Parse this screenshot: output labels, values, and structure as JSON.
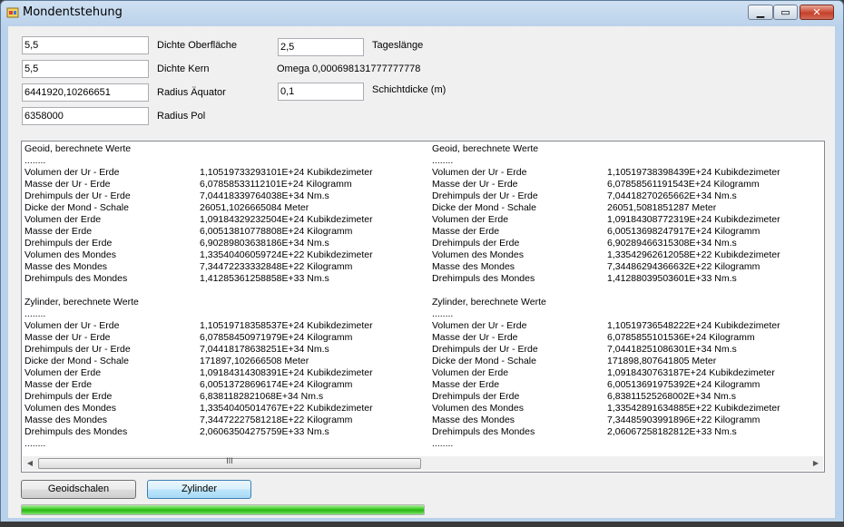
{
  "window": {
    "title": "Mondentstehung"
  },
  "inputs": {
    "dichte_oberflaeche": {
      "value": "5,5",
      "label": "Dichte Oberfläche"
    },
    "dichte_kern": {
      "value": "5,5",
      "label": "Dichte Kern"
    },
    "radius_aequator": {
      "value": "6441920,10266651",
      "label": "Radius Äquator"
    },
    "radius_pol": {
      "value": "6358000",
      "label": "Radius Pol"
    },
    "tageslaenge": {
      "value": "2,5",
      "label": "Tageslänge"
    },
    "omega": {
      "text": "Omega 0,000698131777777778"
    },
    "schichtdicke": {
      "value": "0,1",
      "label": "Schichtdicke (m)"
    }
  },
  "output": {
    "left": [
      [
        "Geoid, berechnete Werte",
        ""
      ],
      [
        "........",
        ""
      ],
      [
        "Volumen der Ur - Erde",
        "1,10519733293101E+24 Kubikdezimeter"
      ],
      [
        "Masse der Ur - Erde",
        "6,07858533112101E+24 Kilogramm"
      ],
      [
        "Drehimpuls der Ur - Erde",
        "7,04418339764038E+34 Nm.s"
      ],
      [
        "Dicke der Mond - Schale",
        "26051,1026665084 Meter"
      ],
      [
        "Volumen der Erde",
        "1,09184329232504E+24 Kubikdezimeter"
      ],
      [
        "Masse der Erde",
        "6,00513810778808E+24 Kilogramm"
      ],
      [
        "Drehimpuls der Erde",
        "6,90289803638186E+34 Nm.s"
      ],
      [
        "Volumen des Mondes",
        "1,33540406059724E+22 Kubikdezimeter"
      ],
      [
        "Masse des Mondes",
        "7,34472233332848E+22 Kilogramm"
      ],
      [
        "Drehimpuls des Mondes",
        "1,41285361258858E+33 Nm.s"
      ],
      [
        "",
        ""
      ],
      [
        "Zylinder, berechnete Werte",
        ""
      ],
      [
        "........",
        ""
      ],
      [
        "Volumen der Ur - Erde",
        "1,10519718358537E+24 Kubikdezimeter"
      ],
      [
        "Masse der Ur - Erde",
        "6,07858450971979E+24 Kilogramm"
      ],
      [
        "Drehimpuls der Ur - Erde",
        "7,04418178638251E+34 Nm.s"
      ],
      [
        "Dicke der Mond - Schale",
        "171897,102666508 Meter"
      ],
      [
        "Volumen der Erde",
        "1,09184314308391E+24 Kubikdezimeter"
      ],
      [
        "Masse der Erde",
        "6,00513728696174E+24 Kilogramm"
      ],
      [
        "Drehimpuls der Erde",
        "6,8381182821068E+34 Nm.s"
      ],
      [
        "Volumen des Mondes",
        "1,33540405014767E+22 Kubikdezimeter"
      ],
      [
        "Masse des Mondes",
        "7,34472227581218E+22 Kilogramm"
      ],
      [
        "Drehimpuls des Mondes",
        "2,06063504275759E+33 Nm.s"
      ],
      [
        "........",
        ""
      ]
    ],
    "right": [
      [
        "Geoid, berechnete Werte",
        ""
      ],
      [
        "........",
        ""
      ],
      [
        "Volumen der Ur - Erde",
        "1,10519738398439E+24 Kubikdezimeter"
      ],
      [
        "Masse der Ur - Erde",
        "6,07858561191543E+24 Kilogramm"
      ],
      [
        "Drehimpuls der Ur - Erde",
        "7,04418270265662E+34 Nm.s"
      ],
      [
        "Dicke der Mond - Schale",
        "26051,5081851287 Meter"
      ],
      [
        "Volumen der Erde",
        "1,09184308772319E+24 Kubikdezimeter"
      ],
      [
        "Masse der Erde",
        "6,00513698247917E+24 Kilogramm"
      ],
      [
        "Drehimpuls der Erde",
        "6,90289466315308E+34 Nm.s"
      ],
      [
        "Volumen des Mondes",
        "1,33542962612058E+22 Kubikdezimeter"
      ],
      [
        "Masse des Mondes",
        "7,34486294366632E+22 Kilogramm"
      ],
      [
        "Drehimpuls des Mondes",
        "1,41288039503601E+33 Nm.s"
      ],
      [
        "",
        ""
      ],
      [
        "Zylinder, berechnete Werte",
        ""
      ],
      [
        "........",
        ""
      ],
      [
        "Volumen der Ur - Erde",
        "1,10519736548222E+24 Kubikdezimeter"
      ],
      [
        "Masse der Ur - Erde",
        "6,0785855101536E+24 Kilogramm"
      ],
      [
        "Drehimpuls der Ur - Erde",
        "7,04418251086301E+34 Nm.s"
      ],
      [
        "Dicke der Mond - Schale",
        "171898,807641805 Meter"
      ],
      [
        "Volumen der Erde",
        "1,0918430763187E+24 Kubikdezimeter"
      ],
      [
        "Masse der Erde",
        "6,00513691975392E+24 Kilogramm"
      ],
      [
        "Drehimpuls der Erde",
        "6,83811525268002E+34 Nm.s"
      ],
      [
        "Volumen des Mondes",
        "1,33542891634885E+22 Kubikdezimeter"
      ],
      [
        "Masse des Mondes",
        "7,34485903991896E+22 Kilogramm"
      ],
      [
        "Drehimpuls des Mondes",
        "2,06067258182812E+33 Nm.s"
      ],
      [
        "........",
        ""
      ]
    ],
    "scroll_grip": "III"
  },
  "buttons": {
    "geoidschalen": "Geoidschalen",
    "zylinder": "Zylinder"
  },
  "progress": {
    "fraction": 1.0
  },
  "icons": {
    "minimize": "minimize-icon",
    "maximize": "maximize-icon",
    "close": "close-icon"
  }
}
